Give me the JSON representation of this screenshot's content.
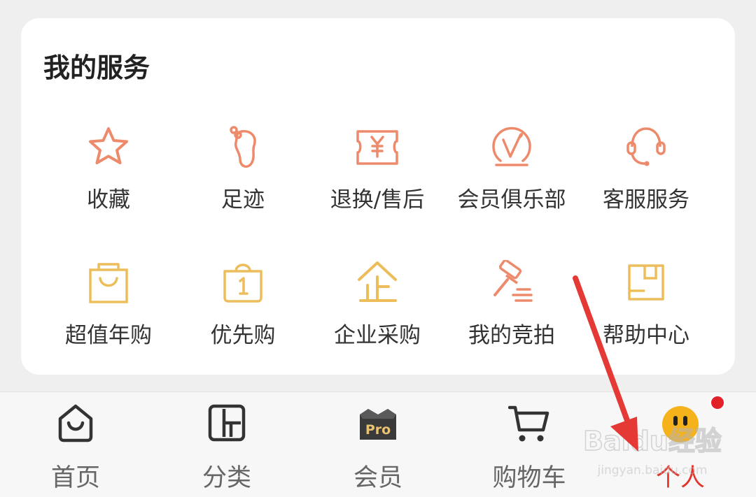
{
  "services": {
    "title": "我的服务",
    "items": [
      {
        "label": "收藏",
        "icon": "star-icon"
      },
      {
        "label": "足迹",
        "icon": "footprint-icon"
      },
      {
        "label": "退换/售后",
        "icon": "ticket-yen-icon"
      },
      {
        "label": "会员俱乐部",
        "icon": "vip-v-icon"
      },
      {
        "label": "客服服务",
        "icon": "headset-icon"
      },
      {
        "label": "超值年购",
        "icon": "shopping-bag-icon"
      },
      {
        "label": "优先购",
        "icon": "priority-bag-icon"
      },
      {
        "label": "企业采购",
        "icon": "enterprise-icon"
      },
      {
        "label": "我的竞拍",
        "icon": "auction-gavel-icon"
      },
      {
        "label": "帮助中心",
        "icon": "help-box-icon"
      }
    ]
  },
  "tabbar": {
    "tabs": [
      {
        "label": "首页",
        "icon": "home-icon"
      },
      {
        "label": "分类",
        "icon": "category-icon"
      },
      {
        "label": "会员",
        "icon": "pro-crown-icon",
        "badge_text": "Pro"
      },
      {
        "label": "购物车",
        "icon": "cart-icon"
      },
      {
        "label": "个人",
        "icon": "profile-face-icon"
      }
    ],
    "active_index": 4
  },
  "watermark": {
    "line1": "Baidu经验",
    "line2": "jingyan.baidu.com"
  },
  "colors": {
    "accent_orange": "#ee8a6c",
    "accent_yellow": "#ecbd5a",
    "active_tab": "#e3352b",
    "annotation_arrow": "#e53935"
  }
}
